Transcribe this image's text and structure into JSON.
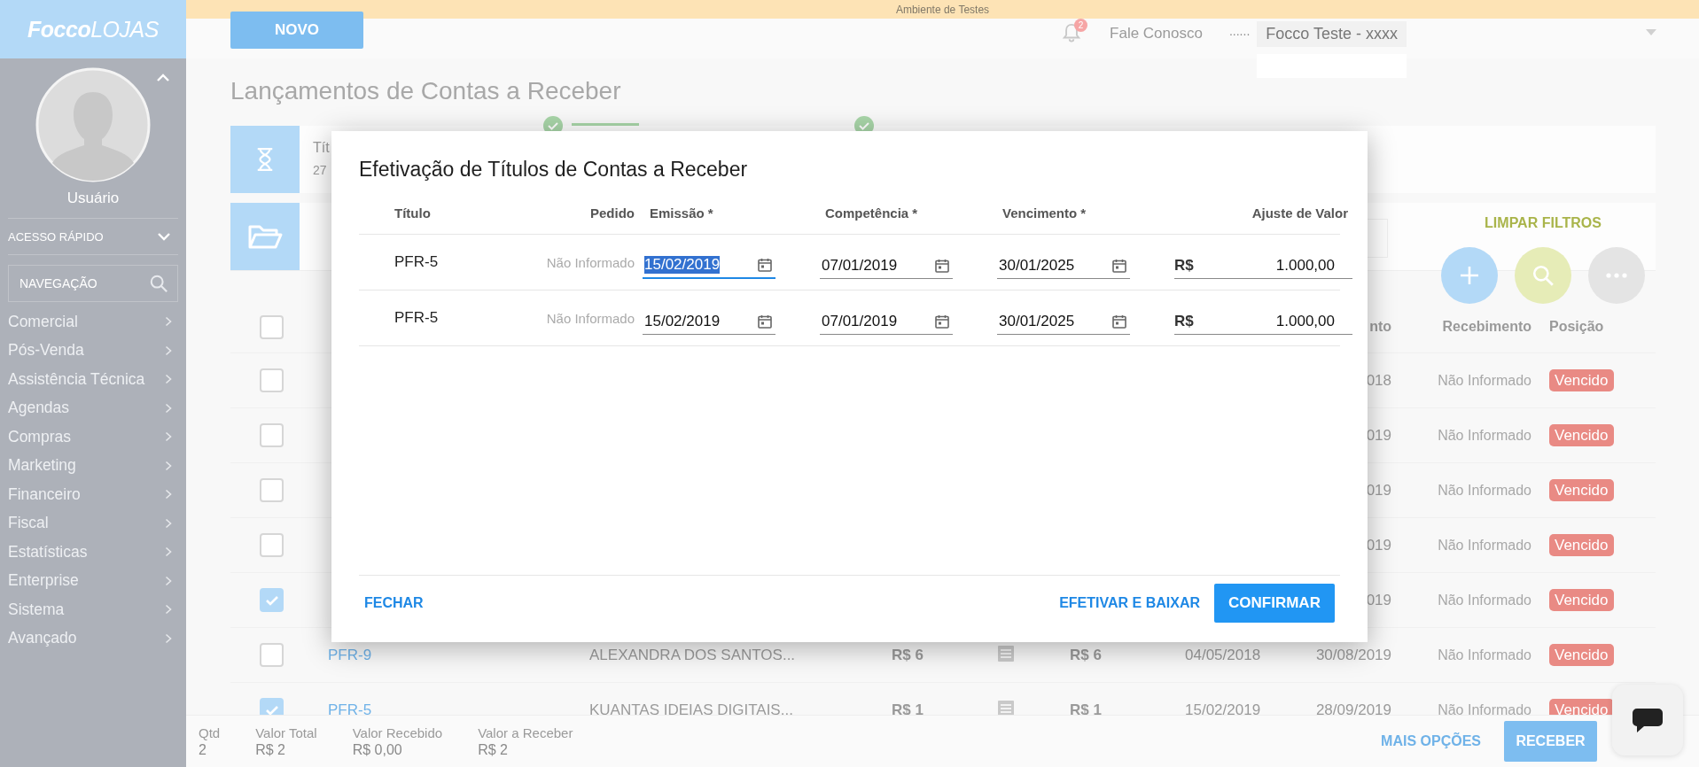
{
  "banner": {
    "text": "Ambiente de Testes"
  },
  "sidebar": {
    "logo": "**Focco**LOJAS",
    "user": "Usuário",
    "quick_access": "ACESSO RÁPIDO",
    "nav_search": {
      "placeholder": "NAVEGAÇÃO"
    },
    "items": [
      {
        "label": "Comercial"
      },
      {
        "label": "Pós-Venda"
      },
      {
        "label": "Assistência Técnica"
      },
      {
        "label": "Agendas"
      },
      {
        "label": "Compras"
      },
      {
        "label": "Marketing"
      },
      {
        "label": "Financeiro"
      },
      {
        "label": "Fiscal"
      },
      {
        "label": "Estatísticas"
      },
      {
        "label": "Enterprise"
      },
      {
        "label": "Sistema"
      },
      {
        "label": "Avançado"
      }
    ]
  },
  "header": {
    "new_button": "NOVO",
    "notification_count": "2",
    "contact": "Fale Conosco",
    "company_prefix": "......",
    "company": "Focco Teste - xxxx"
  },
  "page_title": "Lançamentos de Contas a Receber",
  "summary_card": {
    "title": "Tít",
    "count": "27"
  },
  "filters": {
    "clear": "LIMPAR FILTROS"
  },
  "table": {
    "columns": {
      "due": "nto",
      "receipt": "Recebimento",
      "status": "Posição"
    },
    "all_checked": false,
    "rows": [
      {
        "checked": false,
        "due": "018",
        "receipt": "Não Informado",
        "status": "Vencido"
      },
      {
        "checked": false,
        "due": "019",
        "receipt": "Não Informado",
        "status": "Vencido"
      },
      {
        "checked": false,
        "due": "019",
        "receipt": "Não Informado",
        "status": "Vencido"
      },
      {
        "checked": false,
        "due": "019",
        "receipt": "Não Informado",
        "status": "Vencido"
      },
      {
        "checked": true,
        "due": "019",
        "receipt": "Não Informado",
        "status": "Vencido"
      },
      {
        "checked": false,
        "title": "PFR-9",
        "client": "ALEXANDRA DOS SANTOS...",
        "value": "R$ 6",
        "value_2": "R$ 6",
        "issue": "04/05/2018",
        "due": "30/08/2019",
        "receipt": "Não Informado",
        "status": "Vencido"
      },
      {
        "checked": true,
        "title": "PFR-5",
        "client": "KUANTAS IDEIAS DIGITAIS...",
        "value": "R$ 1",
        "value_2": "R$ 1",
        "issue": "15/02/2019",
        "due": "28/09/2019",
        "receipt": "Não Informado",
        "status": "Vencido"
      }
    ]
  },
  "footer": {
    "totals": [
      {
        "label": "Qtd",
        "value": "2"
      },
      {
        "label": "Valor Total",
        "value": "R$ 2"
      },
      {
        "label": "Valor Recebido",
        "value": "R$ 0,00"
      },
      {
        "label": "Valor a Receber",
        "value": "R$ 2"
      }
    ],
    "more_button": "MAIS OPÇÕES",
    "receive_button": "RECEBER"
  },
  "modal": {
    "title": "Efetivação de Títulos de Contas a Receber",
    "columns": [
      "Título",
      "Pedido",
      "Emissão *",
      "Competência *",
      "Vencimento *",
      "Ajuste de Valor"
    ],
    "rows": [
      {
        "title": "PFR-5",
        "order": "Não Informado",
        "dates": [
          {
            "value": "15/02/2019",
            "focused": true
          },
          {
            "value": "07/01/2019",
            "focused": false
          },
          {
            "value": "30/01/2025",
            "focused": false
          }
        ],
        "currency": "R$",
        "amount": "1.000,00"
      },
      {
        "title": "PFR-5",
        "order": "Não Informado",
        "dates": [
          {
            "value": "15/02/2019",
            "focused": false
          },
          {
            "value": "07/01/2019",
            "focused": false
          },
          {
            "value": "30/01/2025",
            "focused": false
          }
        ],
        "currency": "R$",
        "amount": "1.000,00"
      }
    ],
    "close_button": "FECHAR",
    "settle_button": "EFETIVAR E BAIXAR",
    "confirm_button": "CONFIRMAR"
  }
}
